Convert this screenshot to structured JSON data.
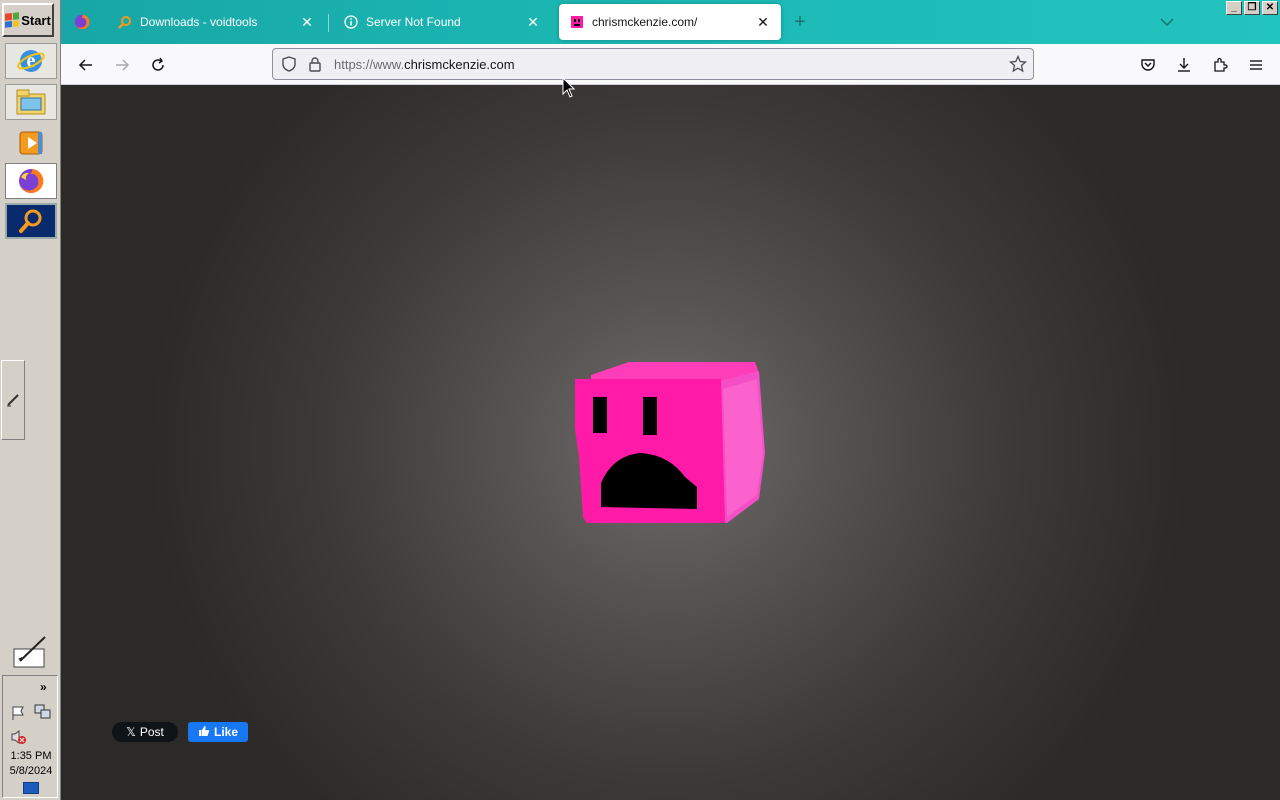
{
  "taskbar": {
    "start_label": "Start",
    "quick_launch": [
      {
        "name": "internet-explorer-icon"
      },
      {
        "name": "windows-explorer-icon"
      },
      {
        "name": "media-player-icon"
      },
      {
        "name": "firefox-icon"
      },
      {
        "name": "search-everything-icon"
      }
    ],
    "tray": {
      "expand_label": "»",
      "time": "1:35 PM",
      "date": "5/8/2024"
    }
  },
  "browser": {
    "tabs": [
      {
        "title": "Downloads - voidtools",
        "icon": "magnifier-icon",
        "active": false
      },
      {
        "title": "Server Not Found",
        "icon": "info-icon",
        "active": false
      },
      {
        "title": "chrismckenzie.com/",
        "icon": "pink-cube-favicon",
        "active": true
      }
    ],
    "new_tab_label": "+",
    "window_controls": [
      "_",
      "❐",
      "✕"
    ],
    "urlbar": {
      "prefix": "https://www.",
      "domain": "chrismckenzie.com"
    }
  },
  "page": {
    "share": {
      "x_label": "Post",
      "fb_label": "Like"
    }
  },
  "colors": {
    "tabstrip": "#1bb6b2",
    "cube_pink": "#ff1aa8",
    "page_bg": "#3d3a39"
  }
}
